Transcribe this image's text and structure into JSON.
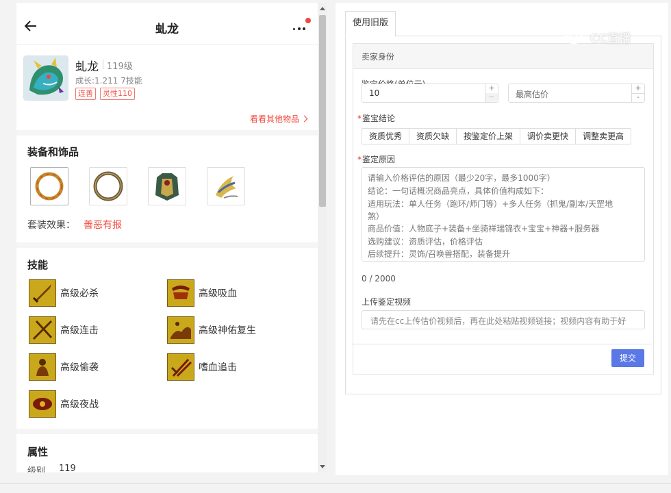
{
  "left": {
    "title": "虬龙",
    "pet": {
      "name": "虬龙",
      "level": "119级",
      "growth": "成长:1.211 7技能",
      "tags": [
        "连善",
        "灵性110"
      ]
    },
    "view_more": "看看其他物品",
    "equip_section": "装备和饰品",
    "equip_items": [
      "ring-gold-icon",
      "ring-dark-icon",
      "armor-icon",
      "claw-icon"
    ],
    "set_label": "套装效果：",
    "set_value": "善恶有报",
    "skill_section": "技能",
    "skills": [
      "高级必杀",
      "高级吸血",
      "高级连击",
      "高级神佑复生",
      "高级偷袭",
      "嗜血追击",
      "高级夜战"
    ],
    "attr_section": "属性",
    "attr": {
      "label": "级别",
      "value": "119"
    }
  },
  "right": {
    "tab": "使用旧版",
    "card_title": "卖家身份",
    "price_label": "鉴宝价格(单位元)",
    "price_value": "10",
    "max_price_placeholder": "最高估价",
    "conclusion_label": "鉴宝结论",
    "conclusion_options": [
      "资质优秀",
      "资质欠缺",
      "按鉴定价上架",
      "调价卖更快",
      "调整卖更高"
    ],
    "reason_label": "鉴定原因",
    "reason_placeholder_lines": [
      "请输入价格评估的原因（最少20字，最多1000字）",
      "   结论：一句话概况商品亮点，具体价值构成如下：",
      "   适用玩法：单人任务（跑环/师门等）+多人任务（抓鬼/副本/天罡地",
      "煞）",
      "   商品价值：人物底子+装备+坐骑祥瑞锦衣+宝宝+神器+服务器",
      "   选购建议：资质评估，价格评估",
      "   后续提升：灵饰/召唤兽搭配，装备提升"
    ],
    "counter": "0 / 2000",
    "video_label": "上传鉴定视频",
    "video_placeholder": "请先在cc上传估价视频后，再在此处粘贴视频链接；视频内容有助于好",
    "submit": "提交"
  },
  "watermark": "CC直播",
  "colors": {
    "accent_red": "#f04b3e",
    "primary_blue": "#5a78e6"
  }
}
